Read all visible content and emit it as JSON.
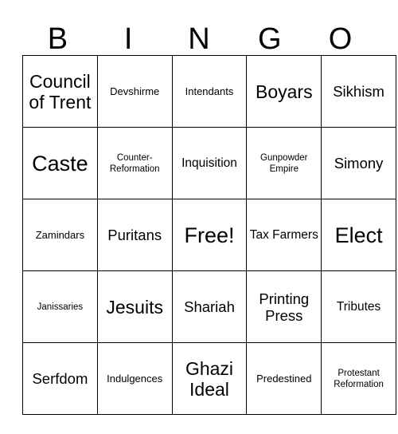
{
  "card": {
    "header_letters": [
      "B",
      "I",
      "N",
      "G",
      "O"
    ],
    "grid": [
      [
        {
          "label": "Council of Trent",
          "size": "xl"
        },
        {
          "label": "Devshirme",
          "size": "sm"
        },
        {
          "label": "Intendants",
          "size": "sm"
        },
        {
          "label": "Boyars",
          "size": "xl"
        },
        {
          "label": "Sikhism",
          "size": "lg"
        }
      ],
      [
        {
          "label": "Caste",
          "size": "xxl"
        },
        {
          "label": "Counter-Reformation",
          "size": "xs"
        },
        {
          "label": "Inquisition",
          "size": "md"
        },
        {
          "label": "Gunpowder Empire",
          "size": "xs"
        },
        {
          "label": "Simony",
          "size": "lg"
        }
      ],
      [
        {
          "label": "Zamindars",
          "size": "sm"
        },
        {
          "label": "Puritans",
          "size": "lg"
        },
        {
          "label": "Free!",
          "size": "xxl"
        },
        {
          "label": "Tax Farmers",
          "size": "md"
        },
        {
          "label": "Elect",
          "size": "xxl"
        },
        {
          "free_space": true
        }
      ],
      [
        {
          "label": "Janissaries",
          "size": "xs"
        },
        {
          "label": "Jesuits",
          "size": "xl"
        },
        {
          "label": "Shariah",
          "size": "lg"
        },
        {
          "label": "Printing Press",
          "size": "lg"
        },
        {
          "label": "Tributes",
          "size": "md"
        }
      ],
      [
        {
          "label": "Serfdom",
          "size": "lg"
        },
        {
          "label": "Indulgences",
          "size": "sm"
        },
        {
          "label": "Ghazi Ideal",
          "size": "xl"
        },
        {
          "label": "Predestined",
          "size": "sm"
        },
        {
          "label": "Protestant Reformation",
          "size": "xs"
        }
      ]
    ],
    "colors": {
      "border": "#000000",
      "text": "#000000",
      "background": "#ffffff"
    }
  }
}
